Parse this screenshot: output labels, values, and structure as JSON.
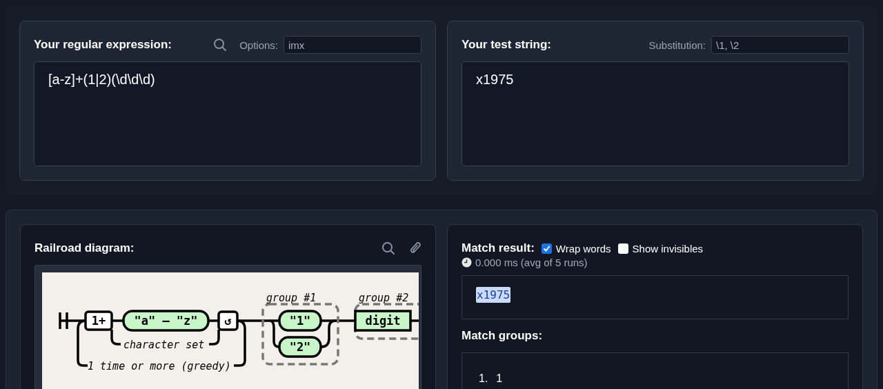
{
  "regex_panel": {
    "title": "Your regular expression:",
    "options_label": "Options:",
    "options_value": "imx",
    "expression": "[a-z]+(1|2)(\\d\\d\\d)"
  },
  "test_panel": {
    "title": "Your test string:",
    "substitution_label": "Substitution:",
    "substitution_value": "\\1, \\2",
    "test_string": "x1975"
  },
  "railroad": {
    "title": "Railroad diagram:",
    "nodes": [
      {
        "kind": "quantifier",
        "label": "1+"
      },
      {
        "kind": "literal",
        "label": "\"a\" – \"z\""
      },
      {
        "kind": "loop",
        "label": "↺"
      },
      {
        "kind": "literal",
        "label": "\"1\""
      },
      {
        "kind": "literal",
        "label": "\"2\""
      },
      {
        "kind": "class",
        "label": "digit"
      }
    ],
    "captions": [
      "character set",
      "1 time or more (greedy)"
    ],
    "groups": [
      "group #1",
      "group #2"
    ]
  },
  "match_result": {
    "title": "Match result:",
    "options": [
      {
        "label": "Wrap words",
        "checked": true
      },
      {
        "label": "Show invisibles",
        "checked": false
      }
    ],
    "timing": "0.000 ms (avg of 5 runs)",
    "match": "x1975"
  },
  "match_groups": {
    "title": "Match groups:",
    "items": [
      {
        "number": "1.",
        "value": "1"
      }
    ]
  }
}
